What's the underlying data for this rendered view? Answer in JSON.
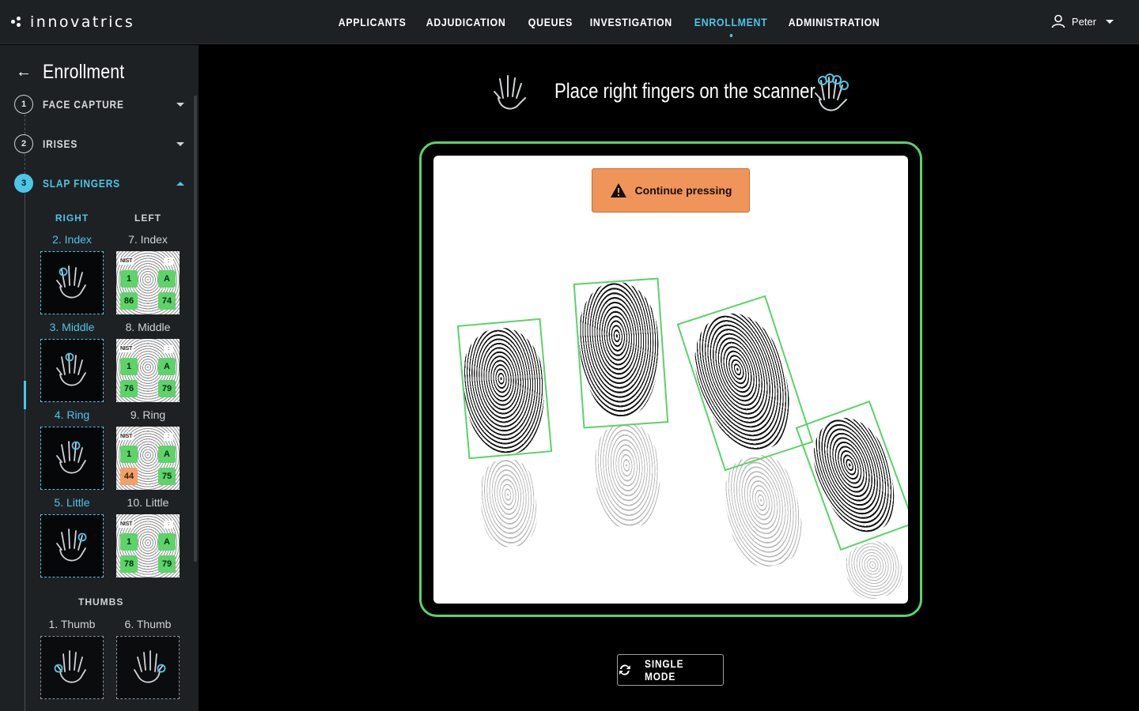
{
  "app": {
    "brand": "innovatrics"
  },
  "nav": {
    "items": [
      "APPLICANTS",
      "ADJUDICATION",
      "QUEUES",
      "INVESTIGATION",
      "ENROLLMENT",
      "ADMINISTRATION"
    ],
    "active": "ENROLLMENT"
  },
  "user": {
    "name": "Peter"
  },
  "sidebar": {
    "title": "Enrollment",
    "steps": [
      {
        "num": "1",
        "label": "FACE CAPTURE"
      },
      {
        "num": "2",
        "label": "IRISES"
      },
      {
        "num": "3",
        "label": "SLAP FINGERS"
      }
    ],
    "columns": {
      "right": "RIGHT",
      "left": "LEFT",
      "thumbs": "THUMBS"
    },
    "fingers": [
      {
        "right": "2. Index",
        "left": "7. Index",
        "nist": "1",
        "score": "86",
        "grade": "A",
        "grade_score": "74"
      },
      {
        "right": "3. Middle",
        "left": "8. Middle",
        "nist": "1",
        "score": "76",
        "grade": "A",
        "grade_score": "79"
      },
      {
        "right": "4. Ring",
        "left": "9. Ring",
        "nist": "1",
        "score": "44",
        "grade": "A",
        "grade_score": "75"
      },
      {
        "right": "5. Little",
        "left": "10. Little",
        "nist": "1",
        "score": "78",
        "grade": "A",
        "grade_score": "79"
      }
    ],
    "thumbs": {
      "right": "1. Thumb",
      "left": "6. Thumb"
    },
    "nist_label": "NIST"
  },
  "main": {
    "instruction": "Place right fingers on the scanner",
    "warning": "Continue pressing",
    "mode_button": "SINGLE MODE"
  },
  "colors": {
    "accent": "#4cc6e6",
    "ok": "#5ad36a",
    "warn": "#f0955a"
  }
}
